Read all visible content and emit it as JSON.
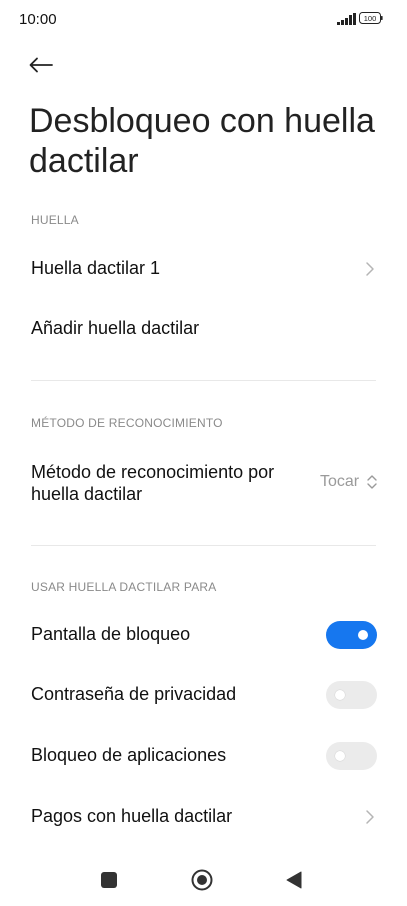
{
  "status_bar": {
    "time": "10:00",
    "battery": "100"
  },
  "header": {
    "title": "Desbloqueo con huella dactilar",
    "back_icon": "arrow-left-icon"
  },
  "sections": {
    "fingerprint": {
      "header": "HUELLA",
      "items": [
        {
          "label": "Huella dactilar 1"
        },
        {
          "label": "Añadir huella dactilar"
        }
      ]
    },
    "recognition": {
      "header": "MÉTODO DE RECONOCIMIENTO",
      "item": {
        "label": "Método de reconocimiento por huella dactilar",
        "value": "Tocar"
      }
    },
    "usage": {
      "header": "USAR HUELLA DACTILAR PARA",
      "items": [
        {
          "label": "Pantalla de bloqueo",
          "enabled": true
        },
        {
          "label": "Contraseña de privacidad",
          "enabled": false
        },
        {
          "label": "Bloqueo de aplicaciones",
          "enabled": false
        },
        {
          "label": "Pagos con huella dactilar"
        }
      ]
    }
  },
  "colors": {
    "accent": "#1677ef",
    "toggle_off": "#ebebeb",
    "secondary_text": "#8a8a8a"
  }
}
